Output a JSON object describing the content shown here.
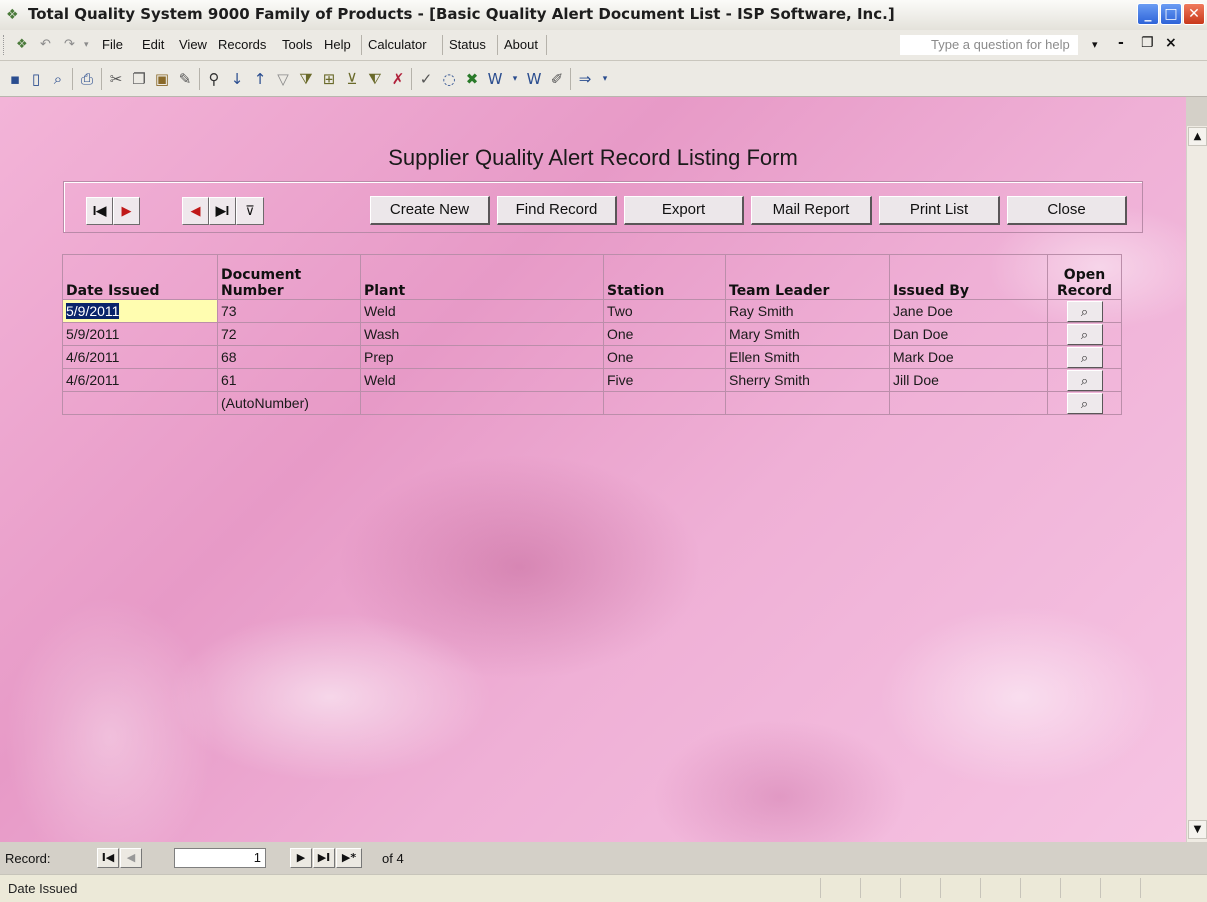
{
  "window": {
    "title": "Total Quality System 9000 Family of Products - [Basic Quality Alert Document List - ISP Software, Inc.]",
    "minimize": "_",
    "maximize": "□",
    "close": "✕"
  },
  "menubar": {
    "items": [
      "File",
      "Edit",
      "View",
      "Records",
      "Tools",
      "Help",
      "Calculator",
      "Status",
      "About"
    ],
    "help_placeholder": "Type a question for help",
    "help_arrow": "▾",
    "mdi_min": "-",
    "mdi_restore": "❐",
    "mdi_close": "×"
  },
  "form": {
    "title": "Supplier Quality Alert Record Listing Form",
    "nav": {
      "first": "I◀",
      "next": "▶",
      "prev": "◀",
      "last": "▶I",
      "filter": "⊽"
    },
    "buttons": {
      "create_new": "Create New",
      "find_record": "Find Record",
      "export": "Export",
      "mail_report": "Mail Report",
      "print_list": "Print List",
      "close": "Close"
    },
    "columns": {
      "date_issued": "Date Issued",
      "document_number": "Document Number",
      "plant": "Plant",
      "station": "Station",
      "team_leader": "Team Leader",
      "issued_by": "Issued By",
      "open_record": "Open Record"
    },
    "rows": [
      {
        "date": "5/9/2011",
        "doc": "73",
        "plant": "Weld",
        "station": "Two",
        "leader": "Ray Smith",
        "issued": "Jane Doe"
      },
      {
        "date": "5/9/2011",
        "doc": "72",
        "plant": "Wash",
        "station": "One",
        "leader": "Mary Smith",
        "issued": "Dan Doe"
      },
      {
        "date": "4/6/2011",
        "doc": "68",
        "plant": "Prep",
        "station": "One",
        "leader": "Ellen Smith",
        "issued": "Mark Doe"
      },
      {
        "date": "4/6/2011",
        "doc": "61",
        "plant": "Weld",
        "station": "Five",
        "leader": "Sherry Smith",
        "issued": "Jill Doe"
      },
      {
        "date": "",
        "doc": "(AutoNumber)",
        "plant": "",
        "station": "",
        "leader": "",
        "issued": ""
      }
    ]
  },
  "recordbar": {
    "label": "Record:",
    "current": "1",
    "of_text": "of 4",
    "first": "I◀",
    "prev": "◀",
    "next": "▶",
    "last": "▶I",
    "new": "▶*"
  },
  "statusbar": {
    "text": "Date Issued"
  }
}
